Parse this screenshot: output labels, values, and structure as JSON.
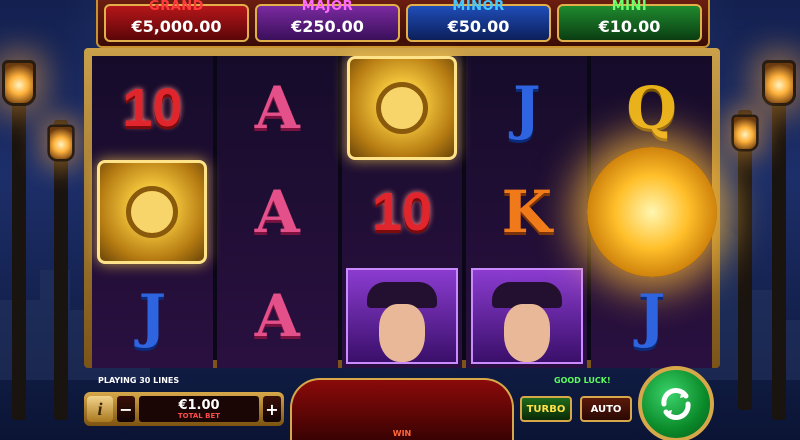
{
  "jackpots": [
    {
      "name": "GRAND",
      "value": "€5,000.00"
    },
    {
      "name": "MAJOR",
      "value": "€250.00"
    },
    {
      "name": "MINOR",
      "value": "€50.00"
    },
    {
      "name": "MINI",
      "value": "€10.00"
    }
  ],
  "reels": [
    [
      "10",
      "vault",
      "J"
    ],
    [
      "A",
      "A",
      "A"
    ],
    [
      "vault",
      "10",
      "lady"
    ],
    [
      "J",
      "K",
      "lady"
    ],
    [
      "Q",
      "glow",
      "J"
    ]
  ],
  "panel": {
    "lines_text": "PLAYING 30 LINES",
    "good_luck": "GOOD LUCK!",
    "info_label": "i",
    "minus_label": "−",
    "plus_label": "+",
    "bet_value": "€1.00",
    "bet_label": "TOTAL BET",
    "win_label": "WIN",
    "turbo_label": "TURBO",
    "auto_label": "AUTO",
    "spin_icon": "refresh-arrows"
  },
  "colors": {
    "frame_gold": "#caa04a",
    "grand": "#ff3b3b",
    "major": "#ff6bff",
    "minor": "#44c8ff",
    "mini": "#6bff6b"
  }
}
